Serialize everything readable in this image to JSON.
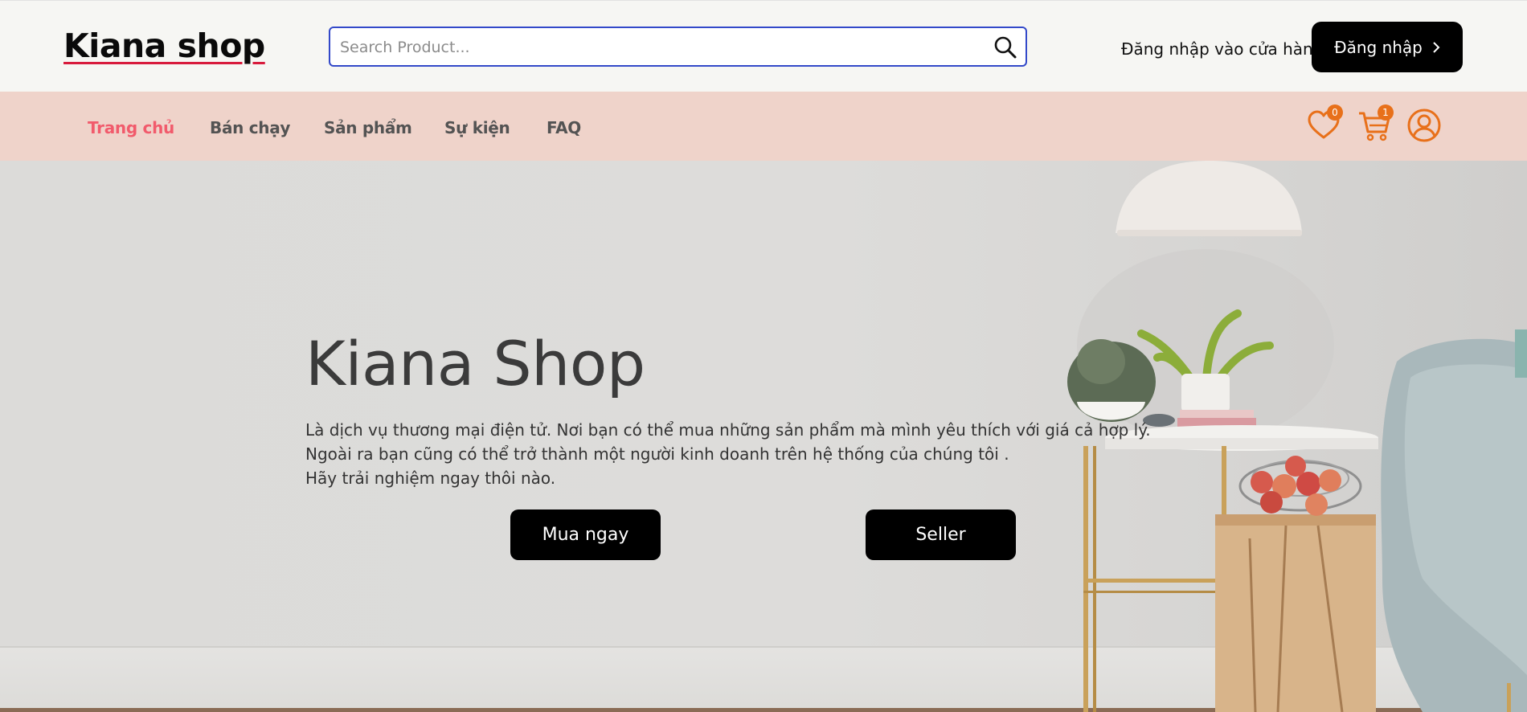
{
  "header": {
    "logo": "Kiana shop",
    "search_placeholder": "Search Product...",
    "search_icon": "search-icon",
    "seller_login_label": "Đăng nhập vào cửa hàng",
    "login_button_label": "Đăng nhập"
  },
  "nav": {
    "items": [
      {
        "label": "Trang chủ",
        "active": true
      },
      {
        "label": "Bán chạy",
        "active": false
      },
      {
        "label": "Sản phẩm",
        "active": false
      },
      {
        "label": "Sự kiện",
        "active": false
      },
      {
        "label": "FAQ",
        "active": false
      }
    ],
    "wishlist_count": "0",
    "cart_count": "1",
    "icons": [
      "heart-icon",
      "cart-icon",
      "user-icon"
    ]
  },
  "hero": {
    "title": "Kiana Shop",
    "description_lines": [
      "Là dịch vụ thương mại điện tử. Nơi bạn có thể mua những sản phẩm mà mình yêu thích với giá cả hợp lý.",
      "Ngoài ra bạn cũng có thể trở thành một người kinh doanh trên hệ thống của chúng tôi .",
      "Hãy trải nghiệm ngay thôi nào."
    ],
    "buy_button_label": "Mua ngay",
    "seller_button_label": "Seller"
  },
  "colors": {
    "accent": "#f15b6c",
    "navbar_bg": "#efd3ca",
    "icon_orange": "#e8701a",
    "search_border": "#3349c9",
    "button_bg": "#000000"
  }
}
